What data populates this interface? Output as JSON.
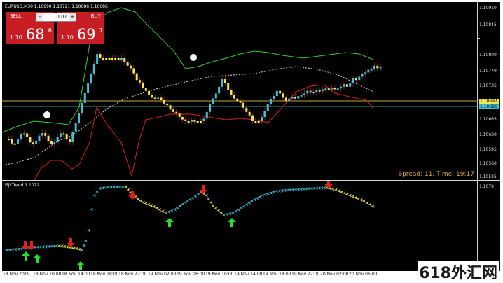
{
  "header": {
    "symbol_text": "EURUSD,M30 1.10690 1.10721 1.10686 1.10686"
  },
  "trade_panel": {
    "sell_label": "SELL",
    "buy_label": "BUY",
    "lot_value": "0.01",
    "lot_down_symbol": "-",
    "lot_up_symbol": "+",
    "sell_quote": {
      "small": "1.10",
      "big": "68",
      "sup": "6"
    },
    "buy_quote": {
      "small": "1.10",
      "big": "69",
      "sup": "7"
    }
  },
  "status": {
    "spread_text": "Spread: 11. Time: 19:17"
  },
  "indicator": {
    "label": "Fiji Trend 1.1072"
  },
  "price_axis": {
    "main_labels": [
      "1.10910",
      "1.10845",
      "1.10800",
      "1.10770",
      "1.10735",
      "1.10697",
      "1.10686",
      "1.10665",
      "1.10630",
      "1.10595",
      "1.10560",
      "1.10525"
    ],
    "current_price_labels": [
      "1.10697",
      "1.10686"
    ],
    "sub_label": "1.1079"
  },
  "time_axis": [
    "18 Nov 2019",
    "18 Nov 10:00",
    "18 Nov 14:00",
    "18 Nov 18:00",
    "18 Nov 22:00",
    "19 Nov 02:00",
    "19 Nov 06:00",
    "19 Nov 10:00",
    "19 Nov 14:00",
    "19 Nov 18:00",
    "19 Nov 22:00",
    "20 Nov 02:00",
    "20 Nov 06:00"
  ],
  "watermark": "618外汇网",
  "colors": {
    "background": "#000000",
    "bull_candle": "#3fc0d8",
    "bear_candle": "#f2e650",
    "upper_band": "#2fd12f",
    "lower_band": "#d81f1f",
    "middle_band": "#d8d8d8",
    "trade_button": "#c81d22",
    "spread_text": "#d9a83a",
    "arrow_up": "#28e028",
    "arrow_down": "#e02020"
  }
}
